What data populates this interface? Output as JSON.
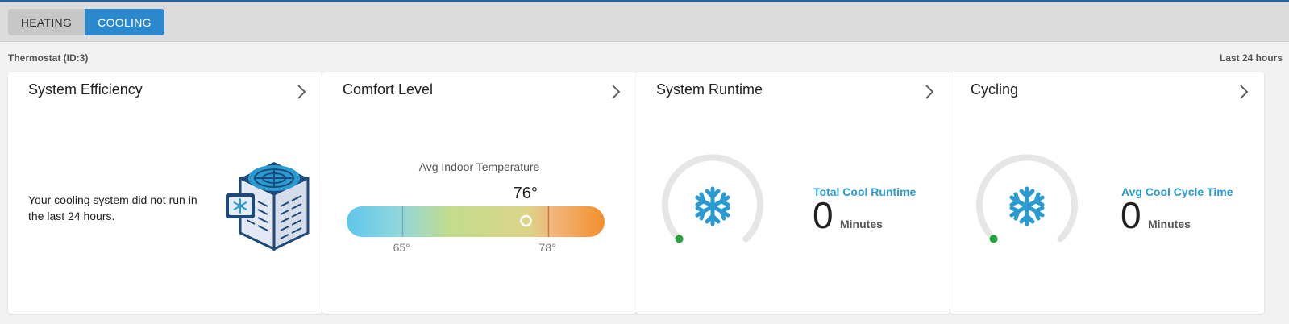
{
  "tabs": [
    {
      "label": "HEATING",
      "active": false
    },
    {
      "label": "COOLING",
      "active": true
    }
  ],
  "device_label": "Thermostat (ID:3)",
  "time_range": "Last 24 hours",
  "colors": {
    "accent": "#2b88cc",
    "stat_label": "#2a9bd0",
    "status_dot": "#22a33c"
  },
  "cards": {
    "efficiency": {
      "title": "System Efficiency",
      "message": "Your cooling system did not run in the last 24 hours.",
      "icon": "ac-unit-icon"
    },
    "comfort": {
      "title": "Comfort Level",
      "avg_label": "Avg Indoor Temperature",
      "value": "76°",
      "value_num": 76,
      "range_min": 60,
      "range_max": 83,
      "low_label": "65°",
      "low_num": 65,
      "high_label": "78°",
      "high_num": 78
    },
    "runtime": {
      "title": "System Runtime",
      "label": "Total Cool Runtime",
      "value": "0",
      "unit": "Minutes",
      "icon": "snowflake-icon"
    },
    "cycling": {
      "title": "Cycling",
      "label": "Avg Cool Cycle Time",
      "value": "0",
      "unit": "Minutes",
      "icon": "snowflake-icon"
    }
  }
}
